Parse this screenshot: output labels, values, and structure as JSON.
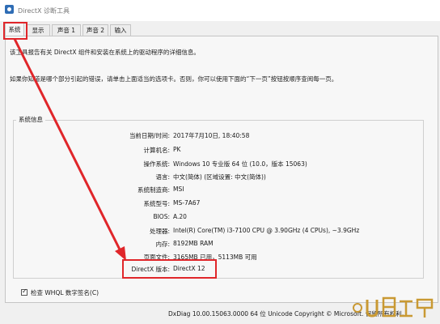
{
  "window": {
    "title": "DirectX 诊断工具"
  },
  "tabs": [
    {
      "label": "系统"
    },
    {
      "label": "显示"
    },
    {
      "label": "声音 1"
    },
    {
      "label": "声音 2"
    },
    {
      "label": "输入"
    }
  ],
  "intro": {
    "line1": "该工具报告有关 DirectX 组件和安装在系统上的驱动程序的详细信息。",
    "line2": "如果你知道是哪个部分引起的错误，请单击上面适当的选项卡。否则，你可以使用下面的“下一页”按钮按顺序查阅每一页。"
  },
  "system_info": {
    "title": "系统信息",
    "rows": [
      {
        "label": "当前日期/时间:",
        "value": "2017年7月10日, 18:40:58"
      },
      {
        "label": "计算机名:",
        "value": "PK"
      },
      {
        "label": "操作系统:",
        "value": "Windows 10 专业版 64 位 (10.0，版本 15063)"
      },
      {
        "label": "语言:",
        "value": "中文(简体) (区域设置: 中文(简体))"
      },
      {
        "label": "系统制造商:",
        "value": "MSI"
      },
      {
        "label": "系统型号:",
        "value": "MS-7A67"
      },
      {
        "label": "BIOS:",
        "value": "A.20"
      },
      {
        "label": "处理器:",
        "value": "Intel(R) Core(TM) i3-7100 CPU @ 3.90GHz (4 CPUs), ~3.9GHz"
      },
      {
        "label": "内存:",
        "value": "8192MB RAM"
      },
      {
        "label": "页面文件:",
        "value": "3165MB 已用，5113MB 可用"
      },
      {
        "label": "DirectX 版本:",
        "value": "DirectX 12"
      }
    ]
  },
  "whql": {
    "label": "检查 WHQL 数字签名(C)",
    "checked": true
  },
  "footer": {
    "text": "DxDiag 10.00.15063.0000 64 位 Unicode  Copyright © Microsoft. 保留所有权利。"
  },
  "annotation": {
    "color": "#e0262a"
  },
  "watermark": {
    "text": "U当家"
  }
}
